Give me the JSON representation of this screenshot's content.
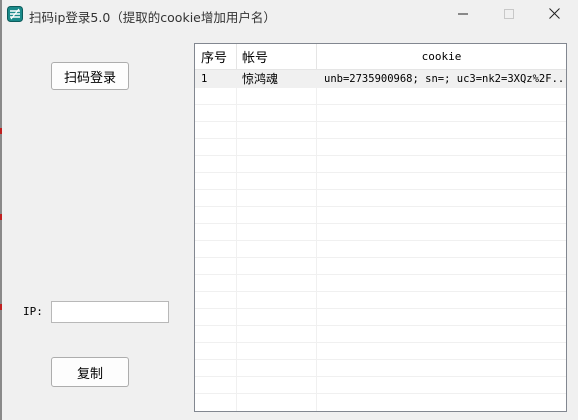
{
  "window": {
    "title": "扫码ip登录5.0（提取的cookie增加用户名）",
    "icon": "app-logo-icon"
  },
  "controls": {
    "scan_login_label": "扫码登录",
    "ip_label": "IP:",
    "ip_value": "",
    "copy_label": "复制"
  },
  "table": {
    "columns": [
      "序号",
      "帐号",
      "cookie"
    ],
    "rows": [
      {
        "index": "1",
        "account": "惊鸿魂",
        "cookie": "unb=2735900968; sn=; uc3=nk2=3XQz%2F..."
      }
    ]
  },
  "colors": {
    "window_bg": "#f0f0f0",
    "list_border": "#828790",
    "selected_row": "#f0f0f0"
  }
}
